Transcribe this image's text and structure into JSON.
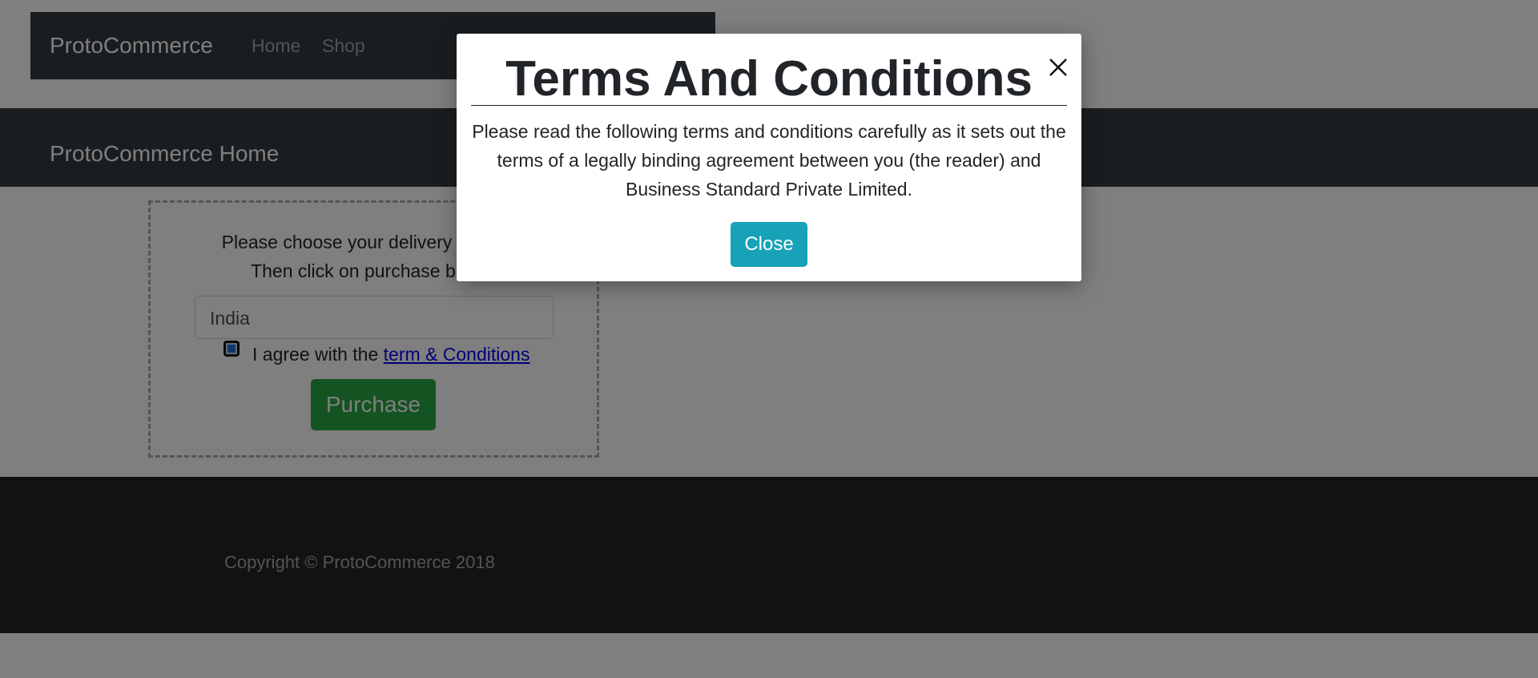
{
  "navbar": {
    "brand": "ProtoCommerce",
    "links": [
      "Home",
      "Shop"
    ]
  },
  "jumbotron": {
    "title": "ProtoCommerce Home"
  },
  "checkout": {
    "instruction_line1": "Please choose your delivery location.",
    "instruction_line2": "Then click on purchase button",
    "country_value": "India",
    "agree_text": "I agree with the ",
    "terms_link": "term & Conditions",
    "checkbox_checked": true,
    "purchase_label": "Purchase"
  },
  "footer": {
    "copyright": "Copyright © ProtoCommerce 2018"
  },
  "modal": {
    "title": "Terms And Conditions",
    "body": "Please read the following terms and conditions carefully as it sets out the terms of a legally binding agreement between you (the reader) and Business Standard Private Limited.",
    "close_label": "Close",
    "close_icon": "close-icon"
  },
  "colors": {
    "navbar_bg": "#343a40",
    "footer_bg": "#202427",
    "purchase_btn": "#28a745",
    "close_btn": "#17a2b8",
    "backdrop": "rgba(0,0,0,0.5)"
  }
}
